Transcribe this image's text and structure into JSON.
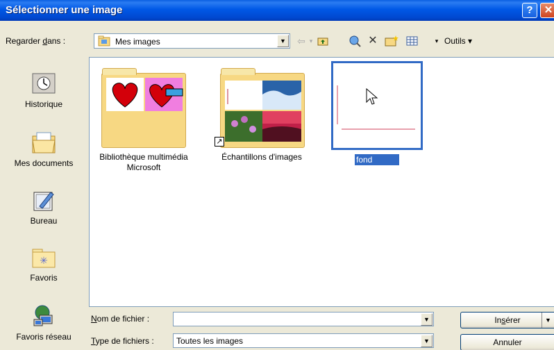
{
  "window": {
    "title": "Sélectionner une image",
    "help_label": "?",
    "close_label": "✕"
  },
  "toolbar": {
    "lookin_label_pre": "Regarder ",
    "lookin_label_u": "d",
    "lookin_label_post": "ans :",
    "lookin_value": "Mes images",
    "tools_label": "Outils ▾"
  },
  "places": [
    {
      "label": "Historique",
      "icon": "history-icon"
    },
    {
      "label": "Mes documents",
      "icon": "my-documents-icon"
    },
    {
      "label": "Bureau",
      "icon": "desktop-icon"
    },
    {
      "label": "Favoris",
      "icon": "favorites-icon"
    },
    {
      "label": "Favoris réseau",
      "icon": "network-places-icon"
    }
  ],
  "files": {
    "item1_label_line1": "Bibliothèque multimédia",
    "item1_label_line2": "Microsoft",
    "item2_label": "Échantillons d'images",
    "item3_label": "fond"
  },
  "fields": {
    "filename_label_u": "N",
    "filename_label_rest": "om de fichier :",
    "filename_value": "",
    "filetype_label_u": "T",
    "filetype_label_rest": "ype de fichiers :",
    "filetype_value": "Toutes les images"
  },
  "buttons": {
    "insert_pre": "In",
    "insert_u": "s",
    "insert_post": "érer",
    "cancel": "Annuler"
  },
  "colors": {
    "titlebar": "#0058e6",
    "selection": "#316ac5",
    "dialog_bg": "#ece9d8"
  }
}
